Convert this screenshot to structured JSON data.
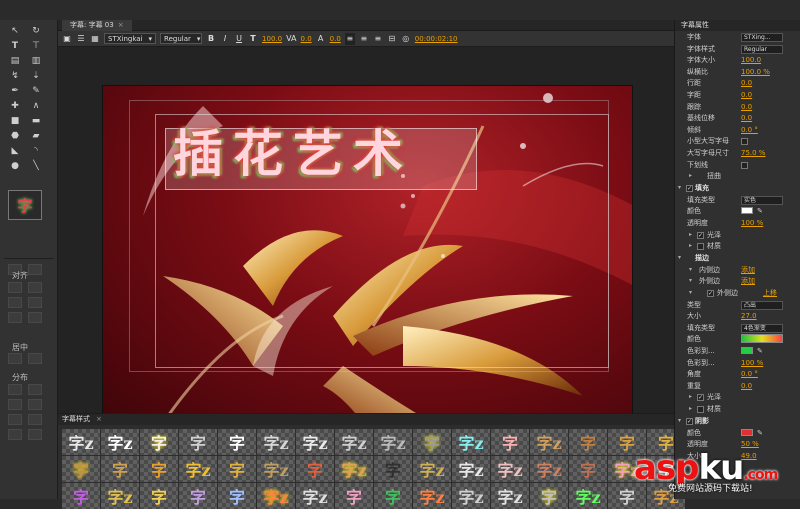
{
  "panel_tab": "字幕: 字幕 03",
  "toolbar": {
    "font_family": "STXingkai",
    "font_style": "Regular",
    "size_value": "100.0",
    "kerning_value": "0.0",
    "leading_value": "0.0",
    "timecode": "00:00:02:10"
  },
  "title_text": "插花艺术",
  "left_panel": {
    "align_label": "对齐",
    "center_label": "居中",
    "distribute_label": "分布",
    "style_thumb_glyph": "字"
  },
  "styles_panel": {
    "tab_label": "字幕样式",
    "swatches": [
      "字z",
      "字z",
      "字",
      "字",
      "字",
      "字z",
      "字z",
      "字z",
      "字z",
      "字",
      "字z",
      "字",
      "字z",
      "字",
      "字",
      "字",
      "字",
      "字",
      "字",
      "字z",
      "字",
      "字z",
      "字",
      "字z",
      "字",
      "字z",
      "字z",
      "字z",
      "字z",
      "字",
      "字z",
      "字",
      "字",
      "字z",
      "字",
      "字",
      "字",
      "字z",
      "字z",
      "字",
      "字",
      "字z",
      "字z",
      "字z",
      "字",
      "字z",
      "字",
      "字z"
    ]
  },
  "properties": {
    "tab_label": "字幕属性",
    "rows": [
      {
        "label": "字体",
        "dropdown": "STXing..."
      },
      {
        "label": "字体样式",
        "dropdown": "Regular"
      },
      {
        "label": "字体大小",
        "value": "100.0"
      },
      {
        "label": "纵横比",
        "value": "100.0 %"
      },
      {
        "label": "行距",
        "value": "0.0"
      },
      {
        "label": "字距",
        "value": "0.0"
      },
      {
        "label": "跟踪",
        "value": "0.0"
      },
      {
        "label": "基线位移",
        "value": "0.0"
      },
      {
        "label": "倾斜",
        "value": "0.0 °"
      },
      {
        "label": "小型大写字母",
        "checkbox": true
      },
      {
        "label": "大写字母尺寸",
        "value": "75.0 %"
      },
      {
        "label": "下划线",
        "checkbox": true
      },
      {
        "label": "扭曲",
        "expander": true
      },
      {
        "label": "填充",
        "section": true,
        "checked": true
      },
      {
        "label": "填充类型",
        "dropdown": "实色"
      },
      {
        "label": "颜色",
        "color": "#ffffff"
      },
      {
        "label": "透明度",
        "value": "100 %"
      },
      {
        "label": "光泽",
        "expander": true,
        "checked": true
      },
      {
        "label": "材质",
        "expander": true,
        "checked": false
      },
      {
        "label": "描边",
        "section": true
      },
      {
        "label": "内侧边",
        "link": "添加"
      },
      {
        "label": "外侧边",
        "link": "添加"
      },
      {
        "label": "外侧边",
        "link": "上移",
        "checked": true
      },
      {
        "label": "类型",
        "dropdown": "凸出"
      },
      {
        "label": "大小",
        "value": "27.0"
      },
      {
        "label": "填充类型",
        "dropdown": "4色渐变"
      },
      {
        "label": "颜色",
        "gradient": true
      },
      {
        "label": "色彩到...",
        "color": "#22cc44"
      },
      {
        "label": "色彩到...",
        "value": "100 %"
      },
      {
        "label": "角度",
        "value": "0.0 °"
      },
      {
        "label": "重复",
        "value": "0.0"
      },
      {
        "label": "光泽",
        "checked": true
      },
      {
        "label": "材质",
        "checked": false
      },
      {
        "label": "阴影",
        "section": true,
        "checked": true
      },
      {
        "label": "颜色",
        "color": "#e03030"
      },
      {
        "label": "透明度",
        "value": "50 %"
      },
      {
        "label": "大小",
        "value": "49.0"
      }
    ]
  },
  "watermark": {
    "brand_a": "asp",
    "brand_b": "ku",
    "suffix": ".com",
    "sub": "免费网站源码下载站!"
  },
  "colors": {
    "accent_value": "#e8a000",
    "canvas_bg": "#7a0c14"
  }
}
